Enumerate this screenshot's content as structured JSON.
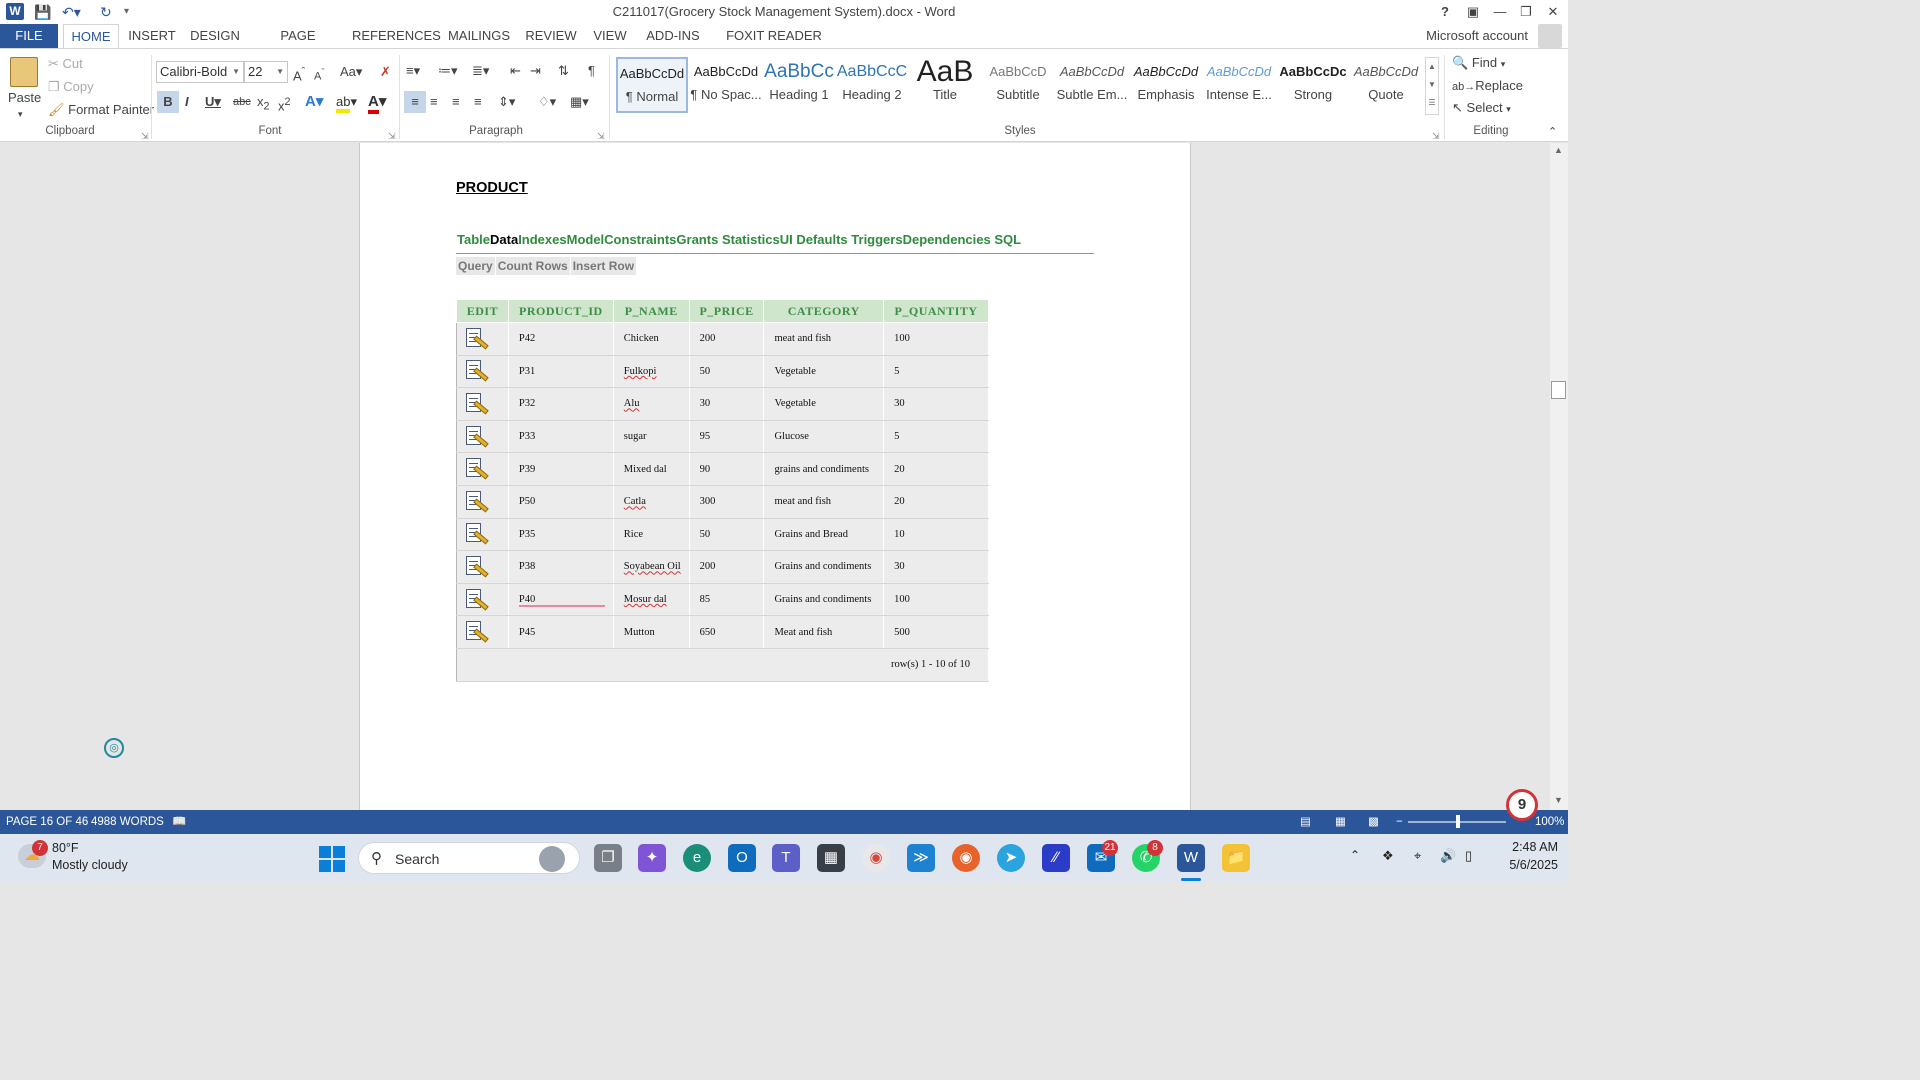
{
  "window": {
    "title": "C211017(Grocery Stock Management System).docx - Word",
    "help": "?",
    "account": "Microsoft account"
  },
  "tabs": [
    "FILE",
    "HOME",
    "INSERT",
    "DESIGN",
    "PAGE LAYOUT",
    "REFERENCES",
    "MAILINGS",
    "REVIEW",
    "VIEW",
    "ADD-INS",
    "FOXIT READER PDF"
  ],
  "ribbon": {
    "clipboard": {
      "paste": "Paste",
      "cut": "Cut",
      "copy": "Copy",
      "format_painter": "Format Painter",
      "label": "Clipboard"
    },
    "font": {
      "name": "Calibri-Bold",
      "size": "22",
      "label": "Font"
    },
    "paragraph": {
      "label": "Paragraph"
    },
    "styles": {
      "label": "Styles",
      "items": [
        {
          "preview": "AaBbCcDd",
          "name": "¶ Normal"
        },
        {
          "preview": "AaBbCcDd",
          "name": "¶ No Spac..."
        },
        {
          "preview": "AaBbCc",
          "name": "Heading 1"
        },
        {
          "preview": "AaBbCcC",
          "name": "Heading 2"
        },
        {
          "preview": "AaB",
          "name": "Title"
        },
        {
          "preview": "AaBbCcD",
          "name": "Subtitle"
        },
        {
          "preview": "AaBbCcDd",
          "name": "Subtle Em..."
        },
        {
          "preview": "AaBbCcDd",
          "name": "Emphasis"
        },
        {
          "preview": "AaBbCcDd",
          "name": "Intense E..."
        },
        {
          "preview": "AaBbCcDc",
          "name": "Strong"
        },
        {
          "preview": "AaBbCcDd",
          "name": "Quote"
        }
      ]
    },
    "editing": {
      "find": "Find",
      "replace": "Replace",
      "select": "Select",
      "label": "Editing"
    }
  },
  "document": {
    "heading": "PRODUCT",
    "apex_tabs": [
      "Table",
      "Data",
      "Indexes",
      "Model",
      "Constraints",
      "Grants",
      "Statistics",
      "UI Defaults",
      "Triggers",
      "Dependencies",
      "SQL"
    ],
    "apex_buttons": [
      "Query",
      "Count Rows",
      "Insert Row"
    ],
    "table": {
      "headers": [
        "EDIT",
        "PRODUCT_ID",
        "P_NAME",
        "P_PRICE",
        "CATEGORY",
        "P_QUANTITY"
      ],
      "rows": [
        [
          "P42",
          "Chicken",
          "200",
          "meat and fish",
          "100"
        ],
        [
          "P31",
          "Fulkopi",
          "50",
          "Vegetable",
          "5"
        ],
        [
          "P32",
          "Alu",
          "30",
          "Vegetable",
          "30"
        ],
        [
          "P33",
          "sugar",
          "95",
          "Glucose",
          "5"
        ],
        [
          "P39",
          "Mixed dal",
          "90",
          "grains and condiments",
          "20"
        ],
        [
          "P50",
          "Catla",
          "300",
          "meat and fish",
          "20"
        ],
        [
          "P35",
          "Rice",
          "50",
          "Grains and Bread",
          "10"
        ],
        [
          "P38",
          "Soyabean Oil",
          "200",
          "Grains and condiments",
          "30"
        ],
        [
          "P40",
          "Mosur dal",
          "85",
          "Grains and condiments",
          "100"
        ],
        [
          "P45",
          "Mutton",
          "650",
          "Meat and fish",
          "500"
        ]
      ],
      "footer": "row(s) 1 - 10 of 10"
    }
  },
  "status": {
    "page": "PAGE 16 OF 46",
    "words": "4988 WORDS",
    "zoom": "100%"
  },
  "taskbar": {
    "weather_temp": "80°F",
    "weather_desc": "Mostly cloudy",
    "weather_badge": "7",
    "search": "Search",
    "time": "2:48 AM",
    "date": "5/6/2025",
    "outlook_badge": "21",
    "whatsapp_badge": "8",
    "notification_count": "9"
  }
}
